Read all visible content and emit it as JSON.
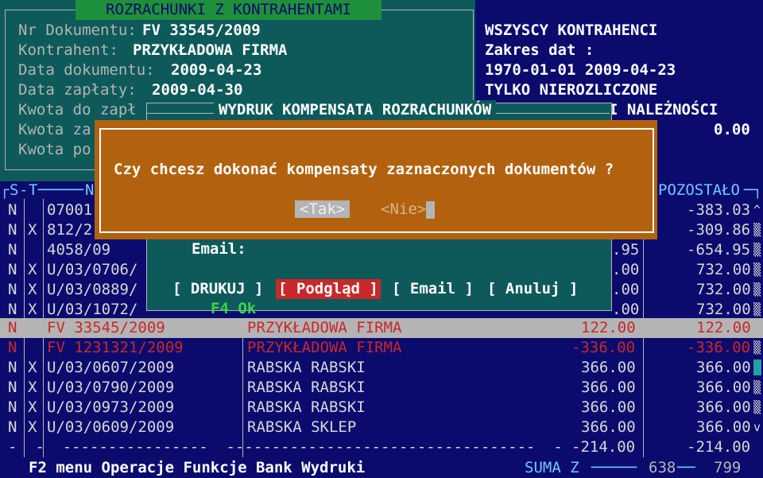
{
  "panel": {
    "title": "ROZRACHUNKI  Z  KONTRAHENTAMI",
    "fields": [
      {
        "label": "Nr Dokumentu:",
        "value": "FV 33545/2009"
      },
      {
        "label": "Kontrahent:",
        "value": "PRZYKŁADOWA FIRMA"
      },
      {
        "label": "Data dokumentu:",
        "value": "2009-04-23"
      },
      {
        "label": "Data zapłaty:",
        "value": "2009-04-30"
      },
      {
        "label": "Kwota do zapł",
        "value": ""
      },
      {
        "label": "Kwota za",
        "value": ""
      },
      {
        "label": "Kwota po",
        "value": ""
      }
    ]
  },
  "filter": {
    "line1": "WSZYSCY KONTRAHENCI",
    "line2": "Zakres dat :",
    "line3": "1970-01-01 2009-04-23",
    "line4": "TYLKO NIEROZLICZONE",
    "line5": "I NALEŻNOŚCI",
    "amount": "0.00"
  },
  "table": {
    "headers": {
      "s": "S",
      "t": "T",
      "n": "N",
      "pozostalo": "POZOSTAŁO"
    },
    "rows_hidden": [
      {
        "s": "N",
        "t": "",
        "nr": "07001",
        "kwota": "",
        "pozostalo": "-383.03"
      },
      {
        "s": "N",
        "t": "X",
        "nr": "812/2",
        "kwota": "",
        "pozostalo": "-309.86"
      },
      {
        "s": "N",
        "t": "",
        "nr": "4058/09",
        "kwota": ".95",
        "pozostalo": "-654.95"
      },
      {
        "s": "N",
        "t": "X",
        "nr": "U/03/0706/",
        "kwota": ".00",
        "pozostalo": "732.00"
      },
      {
        "s": "N",
        "t": "X",
        "nr": "U/03/0889/",
        "kwota": ".00",
        "pozostalo": "732.00"
      },
      {
        "s": "N",
        "t": "X",
        "nr": "U/03/1072/",
        "kwota": ".00",
        "pozostalo": "732.00"
      }
    ],
    "rows": [
      {
        "s": "N",
        "t": "",
        "nr": "FV 33545/2009",
        "kontrahent": "PRZYKŁADOWA FIRMA",
        "kwota": "122.00",
        "pozostalo": "122.00"
      },
      {
        "s": "N",
        "t": "",
        "nr": "FV 1231321/2009",
        "kontrahent": "PRZYKŁADOWA FIRMA",
        "kwota": "-336.00",
        "pozostalo": "-336.00"
      },
      {
        "s": "N",
        "t": "X",
        "nr": "U/03/0607/2009",
        "kontrahent": "RABSKA RABSKI",
        "kwota": "366.00",
        "pozostalo": "366.00"
      },
      {
        "s": "N",
        "t": "X",
        "nr": "U/03/0790/2009",
        "kontrahent": "RABSKA RABSKI",
        "kwota": "366.00",
        "pozostalo": "366.00"
      },
      {
        "s": "N",
        "t": "X",
        "nr": "U/03/0973/2009",
        "kontrahent": "RABSKA RABSKI",
        "kwota": "366.00",
        "pozostalo": "366.00"
      },
      {
        "s": "N",
        "t": "X",
        "nr": "U/03/0609/2009",
        "kontrahent": "RABSKA SKLEP",
        "kwota": "366.00",
        "pozostalo": "366.00"
      }
    ],
    "totals": {
      "kwota": "-214.00",
      "pozostalo": "-214.00"
    }
  },
  "statusbar": {
    "menu": "F2 menu Operacje Funkcje Bank Wydruki",
    "suma": "SUMA Z",
    "n1": "638",
    "n2": "799"
  },
  "print_dialog": {
    "title": "WYDRUK KOMPENSATA ROZRACHUNKÓW",
    "email_label": "Email:",
    "buttons": {
      "drukuj": "[ DRUKUJ ]",
      "podglad": "[ Podgląd ]",
      "email": "[ Email ]",
      "anuluj": "[ Anuluj ]"
    },
    "hint": "F4 Ok"
  },
  "confirm": {
    "question": "Czy chcesz dokonać kompensaty zaznaczonych dokumentów ?",
    "yes": "<Tak>",
    "no": "<Nie>"
  },
  "icons": {
    "scroll_up": "scroll-up-arrow-icon",
    "scroll_down": "scroll-down-arrow-icon",
    "scroll_thumb": "scroll-thumb-icon"
  },
  "colors": {
    "background": "#0b0b6e",
    "panel": "#0e5a5a",
    "dialog": "#b2620f",
    "title_bar": "#1e8f3a",
    "highlight": "#b4b4b4",
    "red_text": "#c8282a",
    "accent_cyan": "#6ec8ff"
  }
}
